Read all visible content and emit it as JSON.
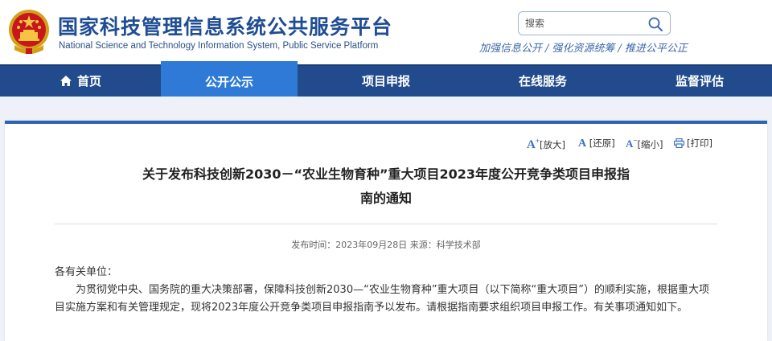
{
  "header": {
    "title": "国家科技管理信息系统公共服务平台",
    "subtitle": "National Science and Technology Information System, Public Service Platform",
    "search_placeholder": "搜索",
    "slogans": [
      "加强信息公开",
      "强化资源统筹",
      "推进公平公正"
    ],
    "slogan_sep": "/"
  },
  "nav": {
    "items": [
      {
        "label": "首页"
      },
      {
        "label": "公开公示"
      },
      {
        "label": "项目申报"
      },
      {
        "label": "在线服务"
      },
      {
        "label": "监督评估"
      }
    ],
    "active_index": 1
  },
  "tools": {
    "enlarge": "[放大]",
    "restore": "[还原]",
    "shrink": "[缩小]",
    "print": "[打印]"
  },
  "article": {
    "title_line1": "关于发布科技创新2030－“农业生物育种”重大项目2023年度公开竞争类项目申报指",
    "title_line2": "南的通知",
    "meta_time_label": "发布时间：",
    "meta_time": "2023年09月28日",
    "meta_source_label": "来源：",
    "meta_source": "科学技术部",
    "greeting": "各有关单位：",
    "para1": "为贯彻党中央、国务院的重大决策部署，保障科技创新2030—“农业生物育种”重大项目（以下简称“重大项目”）的顺利实施，根据重大项目实施方案和有关管理规定，现将2023年度公开竞争类项目申报指南予以发布。请根据指南要求组织项目申报工作。有关事项通知如下。"
  },
  "colors": {
    "brand_blue": "#1f4d94",
    "nav_bg": "#214b8c",
    "nav_active": "#2f7ad6",
    "card_border": "#2f62b0"
  }
}
